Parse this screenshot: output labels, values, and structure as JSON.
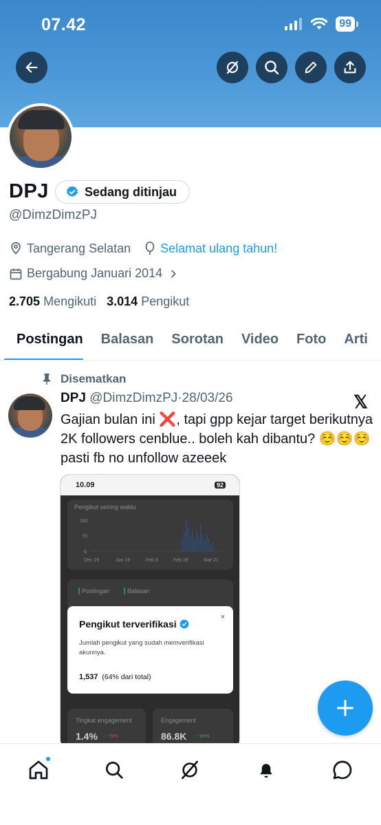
{
  "status_bar": {
    "time": "07.42",
    "battery": "99"
  },
  "profile": {
    "name": "DPJ",
    "badge_label": "Sedang ditinjau",
    "handle": "@DimzDimzPJ",
    "location": "Tangerang Selatan",
    "birthday_text": "Selamat ulang tahun!",
    "joined": "Bergabung Januari 2014",
    "following_count": "2.705",
    "following_label": "Mengikuti",
    "followers_count": "3.014",
    "followers_label": "Pengikut"
  },
  "tabs": [
    {
      "label": "Postingan",
      "active": true
    },
    {
      "label": "Balasan",
      "active": false
    },
    {
      "label": "Sorotan",
      "active": false
    },
    {
      "label": "Video",
      "active": false
    },
    {
      "label": "Foto",
      "active": false
    },
    {
      "label": "Arti",
      "active": false
    }
  ],
  "post": {
    "pinned_label": "Disematkan",
    "author_name": "DPJ",
    "author_handle": "@DimzDimzPJ",
    "separator": "·",
    "date": "28/03/26",
    "text": "Gajian bulan ini ❌, tapi gpp kejar target berikutnya 2K followers cenblue.. boleh kah dibantu? ☺️☺️☺️ pasti fb no unfollow azeeek",
    "embedded": {
      "time": "10.09",
      "battery": "92",
      "chart_title": "Pengikut seiring waktu",
      "y_ticks": [
        "182",
        "91",
        "-5"
      ],
      "x_ticks": [
        "Dec 29",
        "Jan 19",
        "Feb 8",
        "Feb 28",
        "Mar 21"
      ],
      "legend_posts": "Postingan",
      "legend_replies": "Balasan",
      "modal_title": "Pengikut terverifikasi",
      "modal_close": "×",
      "modal_desc": "Jumlah pengikut yang sudah memverifikasi akunnya.",
      "modal_count": "1,537",
      "modal_count_note": "(64% dari total)",
      "engagement_rate_label": "Tingkat engagement",
      "engagement_rate_value": "1.4%",
      "engagement_rate_change": "↓ -78%",
      "engagement_label": "Engagement",
      "engagement_value": "86.8K",
      "engagement_change": "↑ 1K%"
    }
  },
  "colors": {
    "accent": "#1d9bf0",
    "banner": "#4c98d8",
    "text_secondary": "#536471"
  }
}
